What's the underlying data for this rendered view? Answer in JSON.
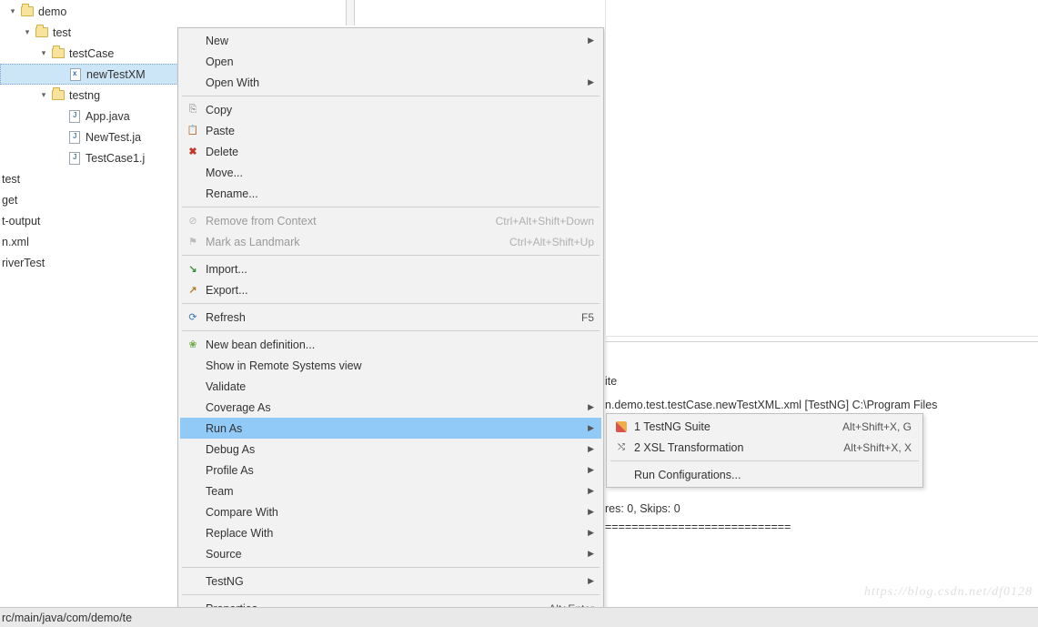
{
  "tree": {
    "items": [
      {
        "label": "demo",
        "expander": "▾",
        "icon": "folder-open",
        "indent": 0
      },
      {
        "label": "test",
        "expander": "▾",
        "icon": "folder-open",
        "indent": 1
      },
      {
        "label": "testCase",
        "expander": "▾",
        "icon": "folder-open",
        "indent": 2
      },
      {
        "label": "newTestXM",
        "expander": "",
        "icon": "xml",
        "indent": 3,
        "selected": true
      },
      {
        "label": "testng",
        "expander": "▾",
        "icon": "folder-open",
        "indent": 2
      },
      {
        "label": "App.java",
        "expander": "",
        "icon": "java",
        "indent": 3
      },
      {
        "label": "NewTest.ja",
        "expander": "",
        "icon": "java",
        "indent": 3
      },
      {
        "label": "TestCase1.j",
        "expander": "",
        "icon": "java",
        "indent": 3
      }
    ],
    "roots": [
      {
        "label": "test"
      },
      {
        "label": "get"
      },
      {
        "label": "t-output"
      },
      {
        "label": "n.xml"
      },
      {
        "label": "riverTest"
      }
    ]
  },
  "context_menu": {
    "groups": [
      [
        {
          "label": "New",
          "submenu": true
        },
        {
          "label": "Open"
        },
        {
          "label": "Open With",
          "submenu": true
        }
      ],
      [
        {
          "label": "Copy",
          "icon": "copy"
        },
        {
          "label": "Paste",
          "icon": "paste"
        },
        {
          "label": "Delete",
          "icon": "del"
        },
        {
          "label": "Move..."
        },
        {
          "label": "Rename..."
        }
      ],
      [
        {
          "label": "Remove from Context",
          "icon": "remctx",
          "kbind": "Ctrl+Alt+Shift+Down",
          "disabled": true
        },
        {
          "label": "Mark as Landmark",
          "icon": "mark",
          "kbind": "Ctrl+Alt+Shift+Up",
          "disabled": true
        }
      ],
      [
        {
          "label": "Import...",
          "icon": "import"
        },
        {
          "label": "Export...",
          "icon": "export"
        }
      ],
      [
        {
          "label": "Refresh",
          "icon": "refresh",
          "kbind": "F5"
        }
      ],
      [
        {
          "label": "New bean definition...",
          "icon": "bean"
        },
        {
          "label": "Show in Remote Systems view"
        },
        {
          "label": "Validate"
        },
        {
          "label": "Coverage As",
          "submenu": true
        },
        {
          "label": "Run As",
          "submenu": true,
          "highlight": true
        },
        {
          "label": "Debug As",
          "submenu": true
        },
        {
          "label": "Profile As",
          "submenu": true
        },
        {
          "label": "Team",
          "submenu": true
        },
        {
          "label": "Compare With",
          "submenu": true
        },
        {
          "label": "Replace With",
          "submenu": true
        },
        {
          "label": "Source",
          "submenu": true
        }
      ],
      [
        {
          "label": "TestNG",
          "submenu": true
        }
      ],
      [
        {
          "label": "Properties",
          "kbind": "Alt+Enter"
        }
      ]
    ]
  },
  "runas_submenu": {
    "items": [
      {
        "label": "1 TestNG Suite",
        "kbind": "Alt+Shift+X, G",
        "icon": "testng"
      },
      {
        "label": "2 XSL Transformation",
        "kbind": "Alt+Shift+X, X",
        "icon": "xsl"
      }
    ],
    "footer": "Run Configurations..."
  },
  "editor": {
    "frag_label_1": "ite",
    "frag_label_2": "n.demo.test.testCase.newTestXML.xml [TestNG] C:\\Program Files"
  },
  "console": {
    "line1": "res: 0, Skips: 0",
    "line2": "============================"
  },
  "pathbar": {
    "text": "rc/main/java/com/demo/te"
  },
  "watermark": "https://blog.csdn.net/df0128"
}
